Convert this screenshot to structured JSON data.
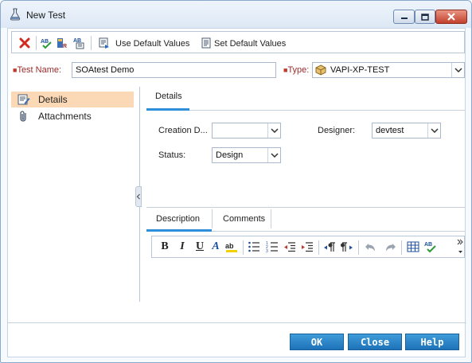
{
  "window": {
    "title": "New Test",
    "controls": [
      "minimize",
      "maximize",
      "close"
    ]
  },
  "toolbar": {
    "delete_icon": "red-x-icon",
    "spell_check_icon": "abc-check-icon",
    "thesaurus_icon": "thesaurus-icon",
    "spelling_options_icon": "spelling-options-icon",
    "use_default_label": "Use Default Values",
    "set_default_label": "Set Default Values"
  },
  "fields": {
    "test_name_label": "Test Name:",
    "test_name_value": "SOAtest Demo",
    "type_label": "Type:",
    "type_value": "VAPI-XP-TEST"
  },
  "sidebar": {
    "items": [
      {
        "label": "Details",
        "icon": "details-icon",
        "selected": true
      },
      {
        "label": "Attachments",
        "icon": "paperclip-icon",
        "selected": false
      }
    ]
  },
  "details": {
    "tab_label": "Details",
    "creation_label": "Creation D...",
    "creation_value": "",
    "designer_label": "Designer:",
    "designer_value": "devtest",
    "status_label": "Status:",
    "status_value": "Design"
  },
  "subtabs": [
    {
      "label": "Description",
      "active": true
    },
    {
      "label": "Comments",
      "active": false
    }
  ],
  "editor": {
    "bold": "B",
    "italic": "I",
    "underline": "U",
    "font_color": "A"
  },
  "buttons": {
    "ok": "OK",
    "close": "Close",
    "help": "Help"
  },
  "colors": {
    "accent": "#2f8fd8",
    "selected_bg": "#fcd9b6",
    "button_blue": "#1e72b8",
    "required_marker": "#c0392b"
  }
}
